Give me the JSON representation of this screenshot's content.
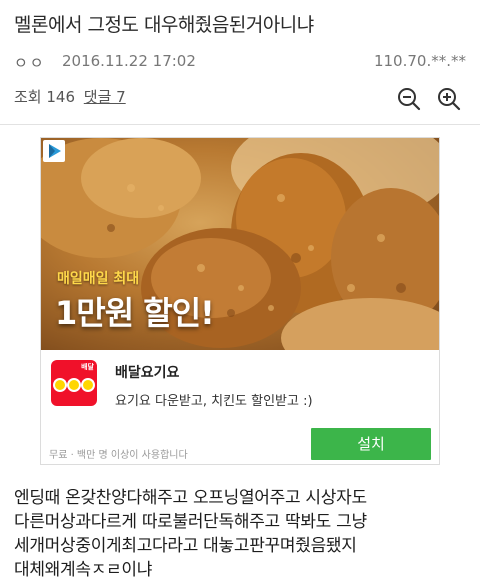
{
  "post": {
    "title": "멜론에서 그정도 대우해줬음된거아니냐",
    "author": "ㅇㅇ",
    "date": "2016.11.22 17:02",
    "ip": "110.70.**.**",
    "views_label": "조회 146",
    "comments_label": "댓글 7"
  },
  "ad": {
    "tag": "매일매일 최대",
    "headline": "1만원 할인!",
    "app_name": "배달요기요",
    "app_desc": "요기요 다운받고, 치킨도 할인받고 :)",
    "app_note": "무료 · 백만 명 이상이 사용합니다",
    "install_label": "설치",
    "logo_word": "배달",
    "colors": {
      "install": "#3cb54a",
      "logo_bg": "#f0112a",
      "logo_dot": "#ffd600"
    }
  },
  "body": {
    "lines": [
      "엔딩때 온갖찬양다해주고 오프닝열어주고 시상자도",
      "다른머상과다르게 따로불러단독해주고 딱봐도 그냥",
      "세개머상중이게최고다라고 대놓고판꾸며줬음됐지",
      "대체왜계속ㅈㄹ이냐"
    ]
  },
  "icons": [
    "zoom-out-icon",
    "zoom-in-icon",
    "ad-play-icon"
  ]
}
